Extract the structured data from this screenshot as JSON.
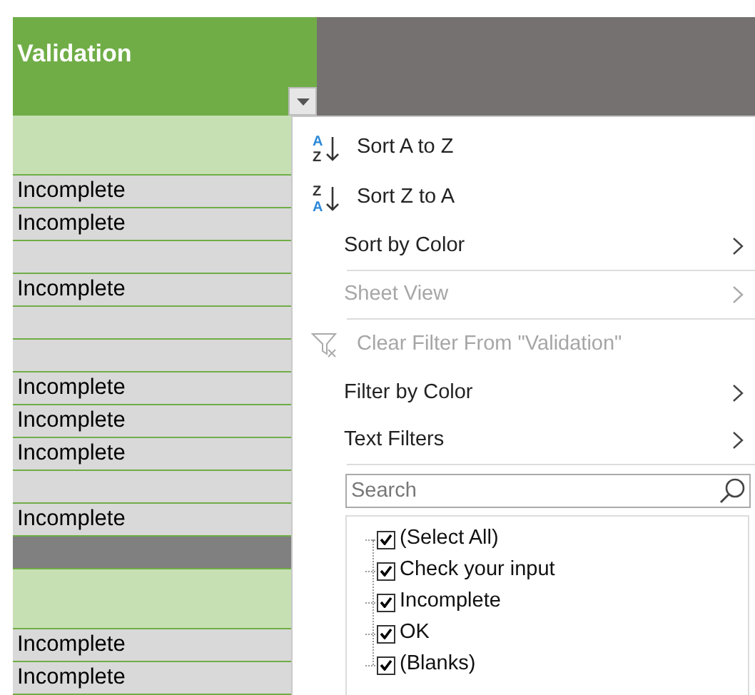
{
  "column_header": {
    "title": "Validation",
    "filter_button": true
  },
  "rows": [
    {
      "kind": "band"
    },
    {
      "kind": "cell",
      "text": "Incomplete"
    },
    {
      "kind": "cell",
      "text": "Incomplete"
    },
    {
      "kind": "cell"
    },
    {
      "kind": "cell",
      "text": "Incomplete"
    },
    {
      "kind": "cell"
    },
    {
      "kind": "cell"
    },
    {
      "kind": "cell",
      "text": "Incomplete"
    },
    {
      "kind": "cell",
      "text": "Incomplete"
    },
    {
      "kind": "cell",
      "text": "Incomplete"
    },
    {
      "kind": "cell"
    },
    {
      "kind": "cell",
      "text": "Incomplete"
    },
    {
      "kind": "dark"
    },
    {
      "kind": "band"
    },
    {
      "kind": "cell",
      "text": "Incomplete"
    },
    {
      "kind": "cell",
      "text": "Incomplete"
    }
  ],
  "filter_menu": {
    "items": [
      {
        "kind": "sort_az",
        "icon_letters": [
          "A",
          "Z"
        ],
        "label": "Sort A to Z",
        "disabled": false,
        "submenu": false
      },
      {
        "kind": "sort_za",
        "icon_letters": [
          "Z",
          "A"
        ],
        "label": "Sort Z to A",
        "disabled": false,
        "submenu": false
      },
      {
        "kind": "plain",
        "label": "Sort by Color",
        "disabled": false,
        "submenu": true
      },
      {
        "kind": "separator"
      },
      {
        "kind": "plain",
        "label": "Sheet View",
        "disabled": true,
        "submenu": true
      },
      {
        "kind": "separator"
      },
      {
        "kind": "clear",
        "label": "Clear Filter From \"Validation\"",
        "disabled": true,
        "submenu": false
      },
      {
        "kind": "plain",
        "label": "Filter by Color",
        "disabled": false,
        "submenu": true
      },
      {
        "kind": "plain",
        "label": "Text Filters",
        "disabled": false,
        "submenu": true
      },
      {
        "kind": "separator"
      }
    ],
    "search": {
      "placeholder": "Search"
    },
    "values": [
      {
        "label": "(Select All)",
        "checked": true
      },
      {
        "label": "Check your input",
        "checked": true
      },
      {
        "label": "Incomplete",
        "checked": true
      },
      {
        "label": "OK",
        "checked": true
      },
      {
        "label": "(Blanks)",
        "checked": true
      }
    ]
  }
}
